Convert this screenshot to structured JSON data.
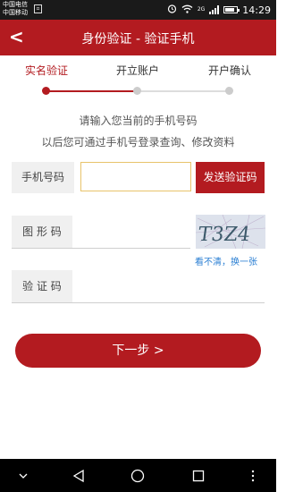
{
  "status_bar": {
    "carrier_1": "中国电信",
    "carrier_2": "中国移动",
    "network_label": "2G",
    "time": "14:29",
    "battery_level": 0.85
  },
  "header": {
    "back_label": "<",
    "title": "身份验证 - 验证手机"
  },
  "steps": [
    {
      "label": "实名验证",
      "active": true
    },
    {
      "label": "开立账户",
      "active": false
    },
    {
      "label": "开户确认",
      "active": false
    }
  ],
  "hints": {
    "line1": "请输入您当前的手机号码",
    "line2": "以后您可通过手机号登录查询、修改资料"
  },
  "form": {
    "phone_label": "手机号码",
    "phone_value": "",
    "send_code_label": "发送验证码",
    "captcha_label": "图 形 码",
    "captcha_text": "T3Z4",
    "refresh_label": "看不清，换一张",
    "code_label": "验 证 码",
    "code_value": ""
  },
  "next_button": "下一步 >",
  "colors": {
    "accent": "#b31b20",
    "link": "#2b7fd3",
    "input_focus_border": "#e8c36a"
  },
  "icons": [
    "sim-icon",
    "alarm-icon",
    "wifi-icon",
    "signal-icon",
    "battery-icon",
    "nav-down-icon",
    "nav-back-icon",
    "nav-home-icon",
    "nav-recents-icon",
    "nav-menu-icon"
  ]
}
